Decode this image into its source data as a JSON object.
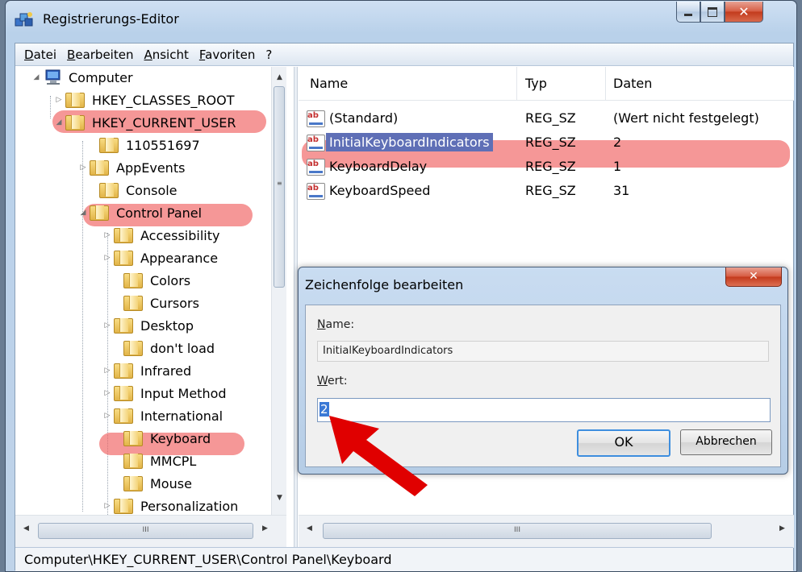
{
  "window": {
    "title": "Registrierungs-Editor",
    "close_glyph": "✕",
    "app_icon": "registry-editor-icon"
  },
  "menu": [
    "Datei",
    "Bearbeiten",
    "Ansicht",
    "Favoriten",
    "?"
  ],
  "tree": {
    "root": "Computer",
    "items": [
      {
        "label": "HKEY_CLASSES_ROOT",
        "expander": "▷"
      },
      {
        "label": "HKEY_CURRENT_USER",
        "expander": "◢",
        "highlighted": true
      },
      {
        "label": "110551697",
        "expander": ""
      },
      {
        "label": "AppEvents",
        "expander": "▷"
      },
      {
        "label": "Console",
        "expander": ""
      },
      {
        "label": "Control Panel",
        "expander": "◢",
        "highlighted": true
      },
      {
        "label": "Accessibility",
        "expander": "▷"
      },
      {
        "label": "Appearance",
        "expander": "▷"
      },
      {
        "label": "Colors",
        "expander": ""
      },
      {
        "label": "Cursors",
        "expander": ""
      },
      {
        "label": "Desktop",
        "expander": "▷"
      },
      {
        "label": "don't load",
        "expander": ""
      },
      {
        "label": "Infrared",
        "expander": "▷"
      },
      {
        "label": "Input Method",
        "expander": "▷"
      },
      {
        "label": "International",
        "expander": "▷"
      },
      {
        "label": "Keyboard",
        "expander": "",
        "highlighted": true
      },
      {
        "label": "MMCPL",
        "expander": ""
      },
      {
        "label": "Mouse",
        "expander": ""
      },
      {
        "label": "Personalization",
        "expander": "▷"
      }
    ]
  },
  "list": {
    "columns": [
      "Name",
      "Typ",
      "Daten"
    ],
    "rows": [
      {
        "name": "(Standard)",
        "type": "REG_SZ",
        "data": "(Wert nicht festgelegt)"
      },
      {
        "name": "InitialKeyboardIndicators",
        "type": "REG_SZ",
        "data": "2",
        "selected": true
      },
      {
        "name": "KeyboardDelay",
        "type": "REG_SZ",
        "data": "1"
      },
      {
        "name": "KeyboardSpeed",
        "type": "REG_SZ",
        "data": "31"
      }
    ]
  },
  "status": "Computer\\HKEY_CURRENT_USER\\Control Panel\\Keyboard",
  "dialog": {
    "title": "Zeichenfolge bearbeiten",
    "close_glyph": "✕",
    "name_label": "Name:",
    "name_value": "InitialKeyboardIndicators",
    "value_label": "Wert:",
    "value": "2",
    "ok": "OK",
    "cancel": "Abbrechen"
  },
  "scroll": {
    "up": "▲",
    "down": "▼",
    "left": "◀",
    "right": "▶",
    "grip": "III"
  },
  "colors": {
    "highlight": "#f05f5f",
    "selection": "#5f6fb6",
    "arrow": "#e00000"
  }
}
